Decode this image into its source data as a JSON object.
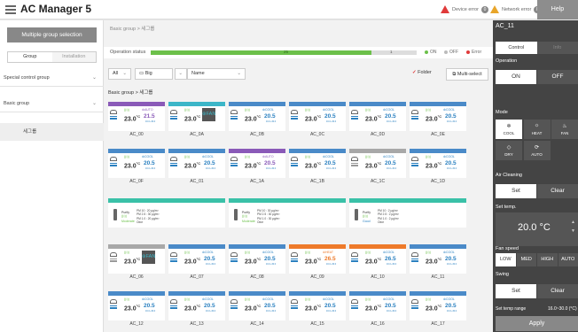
{
  "app": {
    "title": "AC Manager 5"
  },
  "topbar": {
    "device_error": "Device error",
    "device_error_count": "0",
    "network_error": "Network error",
    "network_error_count": "0",
    "help": "Help"
  },
  "sidebar": {
    "multi_group_button": "Multiple group selection",
    "tabs": [
      "Group",
      "Installation"
    ],
    "items": [
      {
        "label": "Special control group"
      },
      {
        "label": "Basic group"
      }
    ],
    "selected_sub": "세그룹"
  },
  "main": {
    "breadcrumb": "Basic group  >  세그룹",
    "status": {
      "label": "Operation status",
      "on_value": "25",
      "err_value": "1",
      "on_fraction": 0.83,
      "legend_on": "ON",
      "legend_off": "OFF",
      "legend_error": "Error"
    },
    "toolbar": {
      "filter_all": "All",
      "view_size": "Big",
      "sort": "Name",
      "folder": "Folder",
      "multi_select": "Multi-select"
    },
    "group_title": "Basic group  >  세그룹"
  },
  "cards_row1": [
    {
      "name": "AC_00",
      "mode": "AUTO",
      "temp": "23",
      "set": "21.5",
      "range": "16.0~30.0",
      "head": "purple"
    },
    {
      "name": "AC_0A",
      "mode": "FAN",
      "temp": "23",
      "set": "",
      "range": "",
      "head": "teal"
    },
    {
      "name": "AC_0B",
      "mode": "COOL",
      "temp": "23",
      "set": "20.5",
      "range": "16.0~30.0",
      "head": "blue"
    },
    {
      "name": "AC_0C",
      "mode": "COOL",
      "temp": "23",
      "set": "20.5",
      "range": "16.0~30.0",
      "head": "blue"
    },
    {
      "name": "AC_0D",
      "mode": "COOL",
      "temp": "23",
      "set": "20.5",
      "range": "16.0~30.0",
      "head": "blue"
    },
    {
      "name": "AC_0E",
      "mode": "COOL",
      "temp": "23",
      "set": "20.5",
      "range": "16.0~30.0",
      "head": "blue"
    }
  ],
  "cards_row2": [
    {
      "name": "AC_0F",
      "mode": "COOL",
      "temp": "23",
      "set": "20.5",
      "range": "16.0~30.0",
      "head": "blue"
    },
    {
      "name": "AC_01",
      "mode": "COOL",
      "temp": "23",
      "set": "20.5",
      "range": "16.0~30.0",
      "head": "blue"
    },
    {
      "name": "AC_1A",
      "mode": "AUTO",
      "temp": "23",
      "set": "20.5",
      "range": "16.0~30.0",
      "head": "purple"
    },
    {
      "name": "AC_1B",
      "mode": "COOL",
      "temp": "23",
      "set": "20.5",
      "range": "16.0~30.0",
      "head": "blue"
    },
    {
      "name": "AC_1C",
      "mode": "COOL",
      "temp": "23",
      "set": "20.5",
      "range": "16.0~30.0",
      "head": "grey"
    },
    {
      "name": "AC_1D",
      "mode": "COOL",
      "temp": "23",
      "set": "20.5",
      "range": "16.0~30.0",
      "head": "blue"
    }
  ],
  "air_units": [
    {
      "label": "Purify",
      "face": "Moderate",
      "pm10": "PM 10 : 20 μg/m³",
      "pm25": "PM 2.5 : 30 μg/m³",
      "pm1": "PM 1.0 : 20 μg/m³",
      "odor": "Odor"
    },
    {
      "label": "Purify",
      "face": "Moderate",
      "pm10": "PM 10 : 30 μg/m³",
      "pm25": "PM 2.5 : 30 μg/m³",
      "pm1": "PM 1.0 : 30 μg/m³",
      "odor": "Odor"
    },
    {
      "label": "Purify",
      "face": "Good",
      "pm10": "PM 10 : 2 μg/m³",
      "pm25": "PM 2.5 : 2 μg/m³",
      "pm1": "PM 1.0 : 2 μg/m³",
      "odor": "Odor"
    }
  ],
  "cards_row4": [
    {
      "name": "AC_06",
      "mode": "FAN",
      "temp": "23",
      "set": "",
      "range": "",
      "head": "grey"
    },
    {
      "name": "AC_07",
      "mode": "COOL",
      "temp": "23",
      "set": "20.5",
      "range": "16.0~30.0",
      "head": "blue"
    },
    {
      "name": "AC_08",
      "mode": "COOL",
      "temp": "23",
      "set": "20.5",
      "range": "16.0~30.0",
      "head": "blue"
    },
    {
      "name": "AC_09",
      "mode": "HEAT",
      "temp": "23",
      "set": "26.5",
      "range": "16.0~30.0",
      "head": "orange"
    },
    {
      "name": "AC_10",
      "mode": "COOL",
      "temp": "23",
      "set": "26.5",
      "range": "16.0~30.0",
      "head": "orange"
    },
    {
      "name": "AC_11",
      "mode": "COOL",
      "temp": "23",
      "set": "20.5",
      "range": "16.0~30.0",
      "head": "blue"
    }
  ],
  "cards_row5": [
    {
      "name": "AC_12",
      "mode": "COOL",
      "temp": "23",
      "set": "20.5",
      "range": "16.0~30.0",
      "head": "blue"
    },
    {
      "name": "AC_13",
      "mode": "COOL",
      "temp": "23",
      "set": "20.5",
      "range": "16.0~30.0",
      "head": "blue"
    },
    {
      "name": "AC_14",
      "mode": "COOL",
      "temp": "23",
      "set": "20.5",
      "range": "16.0~30.0",
      "head": "blue"
    },
    {
      "name": "AC_15",
      "mode": "COOL",
      "temp": "23",
      "set": "20.5",
      "range": "16.0~30.0",
      "head": "blue"
    },
    {
      "name": "AC_16",
      "mode": "COOL",
      "temp": "23",
      "set": "20.5",
      "range": "16.0~30.0",
      "head": "blue"
    },
    {
      "name": "AC_17",
      "mode": "COOL",
      "temp": "23",
      "set": "20.5",
      "range": "16.0~30.0",
      "head": "blue"
    }
  ],
  "panel": {
    "title": "AC_11",
    "tabs": [
      "Control",
      "Info"
    ],
    "operation_label": "Operation",
    "on": "ON",
    "off": "OFF",
    "mode_label": "Mode",
    "modes": [
      {
        "label": "COOL",
        "icon": "❄"
      },
      {
        "label": "HEAT",
        "icon": "☼"
      },
      {
        "label": "FAN",
        "icon": "♨"
      },
      {
        "label": "DRY",
        "icon": "◇"
      },
      {
        "label": "AUTO",
        "icon": "⟳"
      }
    ],
    "air_cleaning_label": "Air Cleaning",
    "set": "Set",
    "clear": "Clear",
    "set_temp_label": "Set temp.",
    "set_temp_value": "20.0 °C",
    "fan_speed_label": "Fan speed",
    "fan_speeds": [
      "LOW",
      "MED",
      "HIGH",
      "AUTO"
    ],
    "swing_label": "Swing",
    "swing_set": "Set",
    "swing_clear": "Clear",
    "range_label": "Set temp range",
    "range_value": "16.0~30.0 (°C)",
    "apply": "Apply"
  },
  "colors": {
    "accent_blue": "#4a8ac8",
    "on_green": "#6cc04a",
    "error_red": "#e03a3a",
    "auto_purple": "#8a5ab8",
    "heat_orange": "#ee7a2a",
    "fan_teal": "#3cb6c8"
  }
}
